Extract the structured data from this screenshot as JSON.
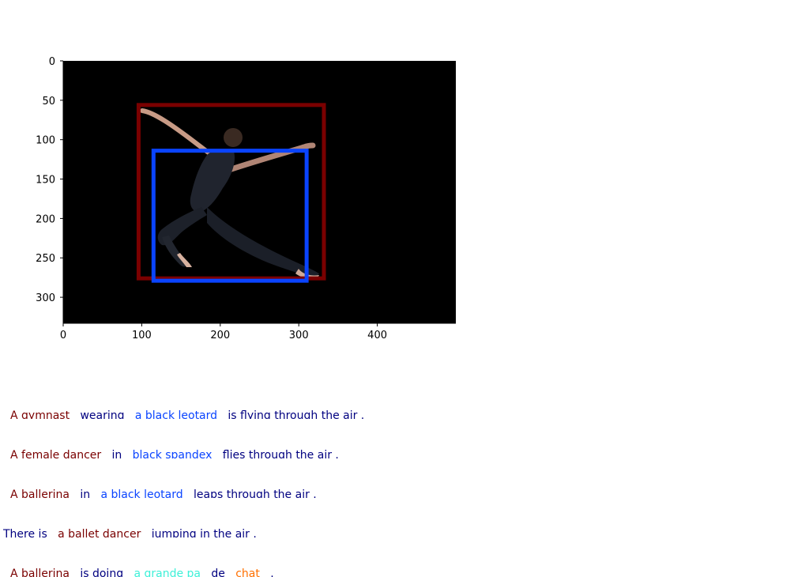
{
  "image_axes": {
    "x_ticks": [
      "0",
      "100",
      "200",
      "300",
      "400"
    ],
    "y_ticks": [
      "0",
      "50",
      "100",
      "150",
      "200",
      "250",
      "300"
    ],
    "x_tick_values": [
      0,
      100,
      200,
      300,
      400
    ],
    "y_tick_values": [
      0,
      50,
      100,
      150,
      200,
      250,
      300
    ],
    "image_width": 500,
    "image_height": 333
  },
  "boxes": [
    {
      "id": "box-red",
      "color": "#7a0000",
      "x0": 96,
      "y0": 56,
      "x1": 332,
      "y1": 276
    },
    {
      "id": "box-blue",
      "color": "#0a44ff",
      "x0": 115,
      "y0": 114,
      "x1": 310,
      "y1": 279
    }
  ],
  "colors": {
    "maroon": "#7a0000",
    "navy": "#000080",
    "blue": "#0a44ff",
    "cyan": "#3ff0d8",
    "orange": "#ff7000"
  },
  "captions": [
    [
      {
        "text": "A gymnast",
        "color": "#7a0000"
      },
      {
        "text": "wearing",
        "color": "#000080"
      },
      {
        "text": "a black leotard",
        "color": "#0a44ff"
      },
      {
        "text": "is flying through the air .",
        "color": "#000080"
      }
    ],
    [
      {
        "text": "A female dancer",
        "color": "#7a0000"
      },
      {
        "text": "in",
        "color": "#000080"
      },
      {
        "text": "black spandex",
        "color": "#0a44ff"
      },
      {
        "text": "flies through the air .",
        "color": "#000080"
      }
    ],
    [
      {
        "text": "A ballerina",
        "color": "#7a0000"
      },
      {
        "text": "in",
        "color": "#000080"
      },
      {
        "text": "a black leotard",
        "color": "#0a44ff"
      },
      {
        "text": "leaps through the air .",
        "color": "#000080"
      }
    ],
    [
      {
        "text": "There is",
        "color": "#000080"
      },
      {
        "text": "a ballet dancer",
        "color": "#7a0000"
      },
      {
        "text": "jumping in the air .",
        "color": "#000080"
      }
    ],
    [
      {
        "text": "A ballerina",
        "color": "#7a0000"
      },
      {
        "text": "is doing",
        "color": "#000080"
      },
      {
        "text": "a grande pa",
        "color": "#3ff0d8"
      },
      {
        "text": "de",
        "color": "#000080"
      },
      {
        "text": "chat",
        "color": "#ff7000"
      },
      {
        "text": ".",
        "color": "#000080"
      }
    ]
  ]
}
